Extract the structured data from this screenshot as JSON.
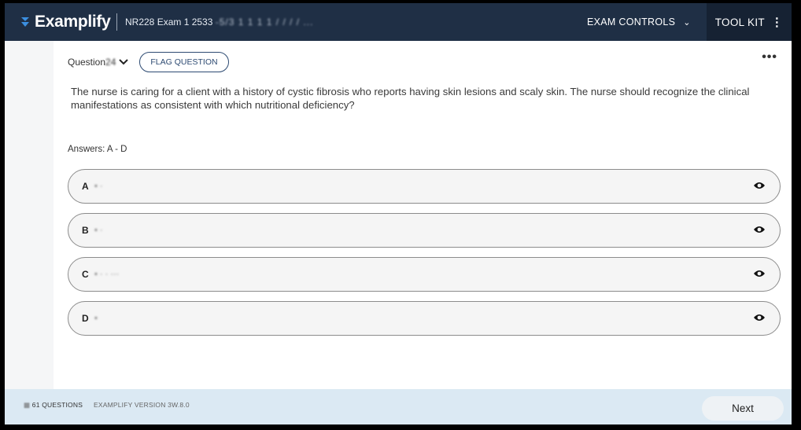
{
  "header": {
    "brand": "Examplify",
    "exam_prefix": "NR228 Exam 1 2533",
    "exam_redacted": "-5/3 1 1 1 1 / / / / ...",
    "exam_controls_label": "EXAM CONTROLS",
    "toolkit_label": "TOOL KIT"
  },
  "question": {
    "label": "Question",
    "number_redacted": "24",
    "flag_label": "FLAG QUESTION",
    "stem": "The nurse is caring for a client with a history of cystic fibrosis who reports having skin lesions and scaly skin. The nurse should recognize the clinical manifestations as consistent with which nutritional deficiency?",
    "answers_label": "Answers: A - D"
  },
  "choices": [
    {
      "letter": "A",
      "text": "• ·"
    },
    {
      "letter": "B",
      "text": "• ·"
    },
    {
      "letter": "C",
      "text": "• · · ···"
    },
    {
      "letter": "D",
      "text": "•"
    }
  ],
  "footer": {
    "question_count": "61 QUESTIONS",
    "version": "EXAMPLIFY VERSION 3W.8.0",
    "next_label": "Next"
  },
  "colors": {
    "header_bg": "#1f2f45",
    "toolkit_bg": "#162233",
    "brand_accent": "#3b8fe0",
    "flag_border": "#2d4a72",
    "footer_bg": "#dbe9f3"
  },
  "icons": [
    "examplify-logo-icon",
    "chevron-down-icon",
    "kebab-vertical-icon",
    "more-horizontal-icon",
    "eye-icon"
  ]
}
